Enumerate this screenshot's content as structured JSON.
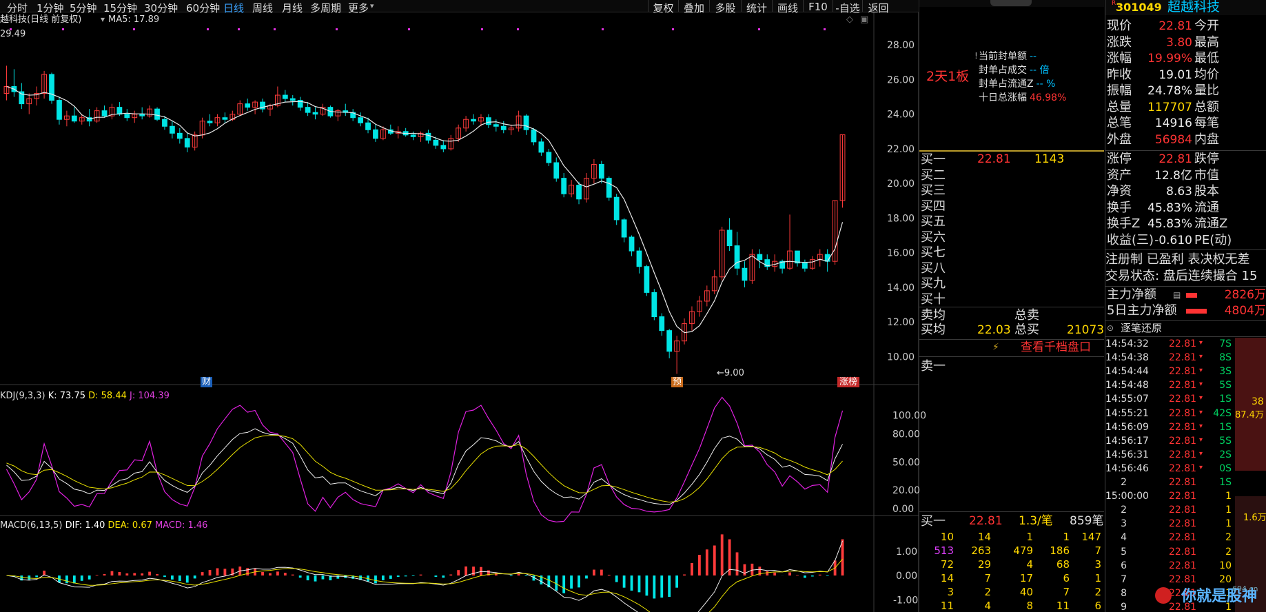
{
  "toolbar": {
    "tabs": [
      "分时",
      "1分钟",
      "5分钟",
      "15分钟",
      "30分钟",
      "60分钟",
      "日线",
      "周线",
      "月线",
      "多周期",
      "更多"
    ],
    "active": "日线",
    "right": [
      "复权",
      "叠加",
      "多股",
      "统计",
      "画线",
      "F10",
      "-自选",
      "返回"
    ]
  },
  "chart_header": {
    "title": "越科技(日线 前复权)",
    "ma5": "MA5: 17.89",
    "high_label": "29.49"
  },
  "markers": {
    "cai": "财",
    "yu": "预",
    "zhangbang": "涨榜",
    "low_label": "9.00"
  },
  "kdj_header": {
    "name": "KDJ(9,3,3)",
    "k": "K: 73.75",
    "d": "D: 58.44",
    "j": "J: 104.39"
  },
  "macd_header": {
    "name": "MACD(6,13,5)",
    "dif": "DIF: 1.40",
    "dea": "DEA: 0.67",
    "macd": "MACD: 1.46"
  },
  "price_axis": [
    "28.00",
    "26.00",
    "24.00",
    "22.00",
    "20.00",
    "18.00",
    "16.00",
    "14.00",
    "12.00",
    "10.00"
  ],
  "kdj_axis": [
    "100.00",
    "80.00",
    "50.00",
    "20.00",
    "0.00"
  ],
  "macd_axis": [
    "1.00",
    "0.00",
    "-1.00"
  ],
  "chart_data": {
    "type": "candlestick",
    "ohlc": [
      [
        25.2,
        26.8,
        24.8,
        25.6
      ],
      [
        25.6,
        26.6,
        25.0,
        25.3
      ],
      [
        25.3,
        25.8,
        24.3,
        24.6
      ],
      [
        24.6,
        25.2,
        24.0,
        24.9
      ],
      [
        24.9,
        25.6,
        24.5,
        25.2
      ],
      [
        25.2,
        26.5,
        24.9,
        26.3
      ],
      [
        26.3,
        26.4,
        24.6,
        24.8
      ],
      [
        24.8,
        25.0,
        23.4,
        23.7
      ],
      [
        23.7,
        24.2,
        23.3,
        23.9
      ],
      [
        23.9,
        24.4,
        23.5,
        23.6
      ],
      [
        23.6,
        24.0,
        23.4,
        23.8
      ],
      [
        23.8,
        24.3,
        23.3,
        23.6
      ],
      [
        23.6,
        24.4,
        23.5,
        24.2
      ],
      [
        24.2,
        24.5,
        23.8,
        23.9
      ],
      [
        23.9,
        24.6,
        23.7,
        24.4
      ],
      [
        24.4,
        24.7,
        23.9,
        24.0
      ],
      [
        24.0,
        24.3,
        23.6,
        23.8
      ],
      [
        23.8,
        24.2,
        23.5,
        24.0
      ],
      [
        24.0,
        24.4,
        23.7,
        23.9
      ],
      [
        23.9,
        24.5,
        23.8,
        24.3
      ],
      [
        24.3,
        24.4,
        23.6,
        23.7
      ],
      [
        23.7,
        23.9,
        23.1,
        23.3
      ],
      [
        23.3,
        23.6,
        22.6,
        22.9
      ],
      [
        22.9,
        23.2,
        22.3,
        22.6
      ],
      [
        22.6,
        22.9,
        21.8,
        22.1
      ],
      [
        22.1,
        23.0,
        21.9,
        22.8
      ],
      [
        22.8,
        23.8,
        22.6,
        23.6
      ],
      [
        23.6,
        24.0,
        23.3,
        23.5
      ],
      [
        23.5,
        24.0,
        23.3,
        23.8
      ],
      [
        23.8,
        24.1,
        23.5,
        23.7
      ],
      [
        23.7,
        24.2,
        23.6,
        24.0
      ],
      [
        24.0,
        24.8,
        23.9,
        24.6
      ],
      [
        24.6,
        24.9,
        24.2,
        24.4
      ],
      [
        24.4,
        24.8,
        24.0,
        24.7
      ],
      [
        24.7,
        24.9,
        24.1,
        24.3
      ],
      [
        24.3,
        24.6,
        23.9,
        24.5
      ],
      [
        24.5,
        25.6,
        24.4,
        25.1
      ],
      [
        25.1,
        25.4,
        24.7,
        24.9
      ],
      [
        24.9,
        25.1,
        24.5,
        24.8
      ],
      [
        24.8,
        25.0,
        24.2,
        24.4
      ],
      [
        24.4,
        24.7,
        23.9,
        24.1
      ],
      [
        24.1,
        24.4,
        23.7,
        24.0
      ],
      [
        24.0,
        24.6,
        23.9,
        24.4
      ],
      [
        24.4,
        24.5,
        23.8,
        23.9
      ],
      [
        23.9,
        24.3,
        23.6,
        24.2
      ],
      [
        24.2,
        24.6,
        23.9,
        24.1
      ],
      [
        24.1,
        24.3,
        23.6,
        23.8
      ],
      [
        23.8,
        24.1,
        23.3,
        23.5
      ],
      [
        23.5,
        23.8,
        22.9,
        23.1
      ],
      [
        23.1,
        23.4,
        22.4,
        22.6
      ],
      [
        22.6,
        23.3,
        22.5,
        23.1
      ],
      [
        23.1,
        23.4,
        22.8,
        22.9
      ],
      [
        22.9,
        23.3,
        22.6,
        23.0
      ],
      [
        23.0,
        23.2,
        22.7,
        22.8
      ],
      [
        22.8,
        23.0,
        22.5,
        22.7
      ],
      [
        22.7,
        23.0,
        22.4,
        22.9
      ],
      [
        22.9,
        23.1,
        22.3,
        22.5
      ],
      [
        22.5,
        22.7,
        22.0,
        22.2
      ],
      [
        22.2,
        22.5,
        21.8,
        22.0
      ],
      [
        22.0,
        22.8,
        21.9,
        22.6
      ],
      [
        22.6,
        23.4,
        22.4,
        23.2
      ],
      [
        23.2,
        23.9,
        23.0,
        23.7
      ],
      [
        23.7,
        24.0,
        23.4,
        23.6
      ],
      [
        23.6,
        24.0,
        23.3,
        23.8
      ],
      [
        23.8,
        24.0,
        23.2,
        23.4
      ],
      [
        23.4,
        23.7,
        23.0,
        23.3
      ],
      [
        23.3,
        23.6,
        22.9,
        23.1
      ],
      [
        23.1,
        23.4,
        22.8,
        23.2
      ],
      [
        23.2,
        24.2,
        23.0,
        23.9
      ],
      [
        23.9,
        24.0,
        22.8,
        23.1
      ],
      [
        23.1,
        23.2,
        22.2,
        22.4
      ],
      [
        22.4,
        22.6,
        21.6,
        21.8
      ],
      [
        21.8,
        22.0,
        21.0,
        21.2
      ],
      [
        21.2,
        21.5,
        20.1,
        20.3
      ],
      [
        20.3,
        20.6,
        19.2,
        19.4
      ],
      [
        19.4,
        20.2,
        19.2,
        19.9
      ],
      [
        19.9,
        20.1,
        18.8,
        19.1
      ],
      [
        19.1,
        20.6,
        18.9,
        20.3
      ],
      [
        20.3,
        21.4,
        20.0,
        21.1
      ],
      [
        21.1,
        21.3,
        20.0,
        20.3
      ],
      [
        20.3,
        20.4,
        19.0,
        19.2
      ],
      [
        19.2,
        19.4,
        17.6,
        17.9
      ],
      [
        17.9,
        18.0,
        16.6,
        16.9
      ],
      [
        16.9,
        17.0,
        15.8,
        16.1
      ],
      [
        16.1,
        16.3,
        14.8,
        15.2
      ],
      [
        15.2,
        15.3,
        13.5,
        13.7
      ],
      [
        13.7,
        13.9,
        12.1,
        12.3
      ],
      [
        12.3,
        12.5,
        11.2,
        11.5
      ],
      [
        11.5,
        11.6,
        9.9,
        10.3
      ],
      [
        10.3,
        11.2,
        9.0,
        10.9
      ],
      [
        10.9,
        12.2,
        10.7,
        11.9
      ],
      [
        11.9,
        12.9,
        11.5,
        12.6
      ],
      [
        12.6,
        13.5,
        12.3,
        13.2
      ],
      [
        13.2,
        14.1,
        12.9,
        13.8
      ],
      [
        13.8,
        15.0,
        13.6,
        14.6
      ],
      [
        14.6,
        17.5,
        14.4,
        17.3
      ],
      [
        17.3,
        18.0,
        16.1,
        16.4
      ],
      [
        16.4,
        17.2,
        14.7,
        15.1
      ],
      [
        15.1,
        15.5,
        14.0,
        14.4
      ],
      [
        14.4,
        16.2,
        14.2,
        15.9
      ],
      [
        15.9,
        16.2,
        15.1,
        15.6
      ],
      [
        15.6,
        15.9,
        15.0,
        15.2
      ],
      [
        15.2,
        15.9,
        14.9,
        15.5
      ],
      [
        15.5,
        15.6,
        14.8,
        15.1
      ],
      [
        15.1,
        18.2,
        15.0,
        16.1
      ],
      [
        16.1,
        16.1,
        15.2,
        15.4
      ],
      [
        15.4,
        15.6,
        14.9,
        15.1
      ],
      [
        15.1,
        15.8,
        15.0,
        15.6
      ],
      [
        15.6,
        16.2,
        15.2,
        15.9
      ],
      [
        15.9,
        16.2,
        14.9,
        15.5
      ],
      [
        15.5,
        19.0,
        15.3,
        19.01
      ],
      [
        19.01,
        22.81,
        18.6,
        22.81
      ]
    ],
    "price_range": [
      8.5,
      29.8
    ],
    "kdj_range": [
      -5,
      118
    ],
    "macd_range": [
      -1.5,
      1.9
    ]
  },
  "right_panel": {
    "board": "2天1板",
    "seal_lines": [
      {
        "label": "当前封单额",
        "value": "--"
      },
      {
        "label": "封单占成交",
        "value": "-- 倍"
      },
      {
        "label": "封单占流通Z",
        "value": "-- %"
      },
      {
        "label": "十日总涨幅",
        "value": "46.98%"
      }
    ],
    "buy_labels": [
      "买一",
      "买二",
      "买三",
      "买四",
      "买五",
      "买六",
      "买七",
      "买八",
      "买九",
      "买十"
    ],
    "buy1_price": "22.81",
    "buy1_vol": "1143",
    "sell_avg_label": "卖均",
    "sell_total_label": "总卖",
    "buy_avg_label": "买均",
    "buy_avg": "22.03",
    "buy_total_label": "总买",
    "buy_total": "21073",
    "qiandang": "查看千档盘口",
    "sell1": "卖一",
    "queue_header": {
      "label": "买一",
      "price": "22.81",
      "per": "1.3/笔",
      "count": "859笔"
    },
    "queue_rows": [
      [
        "10",
        "14",
        "1",
        "1",
        "147"
      ],
      [
        "513",
        "263",
        "479",
        "186",
        "7"
      ],
      [
        "72",
        "29",
        "4",
        "68",
        "3"
      ],
      [
        "14",
        "7",
        "17",
        "6",
        "1"
      ],
      [
        "3",
        "2",
        "40",
        "7",
        "2"
      ],
      [
        "11",
        "4",
        "8",
        "11",
        "6"
      ]
    ]
  },
  "quote": {
    "code": "301049",
    "name": "超越科技",
    "badge": "R",
    "rows": [
      {
        "l1": "现价",
        "v1": "22.81",
        "c1": "red",
        "l2": "今开"
      },
      {
        "l1": "涨跌",
        "v1": "3.80",
        "c1": "red",
        "l2": "最高"
      },
      {
        "l1": "涨幅",
        "v1": "19.99%",
        "c1": "red",
        "l2": "最低"
      },
      {
        "l1": "昨收",
        "v1": "19.01",
        "c1": "white",
        "l2": "均价"
      },
      {
        "l1": "振幅",
        "v1": "24.78%",
        "c1": "white",
        "l2": "量比"
      },
      {
        "l1": "总量",
        "v1": "117707",
        "c1": "yellow",
        "l2": "总额"
      },
      {
        "l1": "总笔",
        "v1": "14916",
        "c1": "white",
        "l2": "每笔"
      },
      {
        "l1": "外盘",
        "v1": "56984",
        "c1": "red",
        "l2": "内盘"
      }
    ],
    "rows2": [
      {
        "l1": "涨停",
        "v1": "22.81",
        "c1": "red",
        "l2": "跌停"
      },
      {
        "l1": "资产",
        "v1": "12.8亿",
        "c1": "white",
        "l2": "市值"
      },
      {
        "l1": "净资",
        "v1": "8.63",
        "c1": "white",
        "l2": "股本"
      },
      {
        "l1": "换手",
        "v1": "45.83%",
        "c1": "white",
        "l2": "流通"
      },
      {
        "l1": "换手Z",
        "v1": "45.83%",
        "c1": "white",
        "l2": "流通Z"
      },
      {
        "l1": "收益(三)",
        "v1": "-0.610",
        "c1": "white",
        "l2": "PE(动)"
      }
    ],
    "reg": "注册制 已盈利 表决权无差",
    "trade_status": "交易状态: 盘后连续撮合 15",
    "main_net": {
      "label": "主力净额",
      "value": "2826万"
    },
    "main_net5": {
      "label": "5日主力净额",
      "value": "4804万"
    },
    "ticks_title": "逐笔还原",
    "ticks": [
      {
        "t": "14:54:32",
        "p": "22.81",
        "v": "7S"
      },
      {
        "t": "14:54:38",
        "p": "22.81",
        "v": "8S"
      },
      {
        "t": "14:54:44",
        "p": "22.81",
        "v": "3S"
      },
      {
        "t": "14:54:48",
        "p": "22.81",
        "v": "5S"
      },
      {
        "t": "14:55:07",
        "p": "22.81",
        "v": "1S"
      },
      {
        "t": "14:55:21",
        "p": "22.81",
        "v": "42S"
      },
      {
        "t": "14:56:09",
        "p": "22.81",
        "v": "1S"
      },
      {
        "t": "14:56:17",
        "p": "22.81",
        "v": "5S"
      },
      {
        "t": "14:56:31",
        "p": "22.81",
        "v": "2S"
      },
      {
        "t": "14:56:46",
        "p": "22.81",
        "v": "0S"
      },
      {
        "t": "2",
        "p": "22.81",
        "v": "1S"
      },
      {
        "t": "15:00:00",
        "p": "22.81",
        "v": "1"
      },
      {
        "t": "2",
        "p": "22.81",
        "v": "1"
      },
      {
        "t": "3",
        "p": "22.81",
        "v": "1"
      },
      {
        "t": "4",
        "p": "22.81",
        "v": "2"
      },
      {
        "t": "5",
        "p": "22.81",
        "v": "2"
      },
      {
        "t": "6",
        "p": "22.81",
        "v": "10"
      },
      {
        "t": "7",
        "p": "22.81",
        "v": "20"
      },
      {
        "t": "8",
        "p": "22.81",
        "v": "1"
      },
      {
        "t": "9",
        "p": "22.81",
        "v": "1"
      }
    ],
    "side_vals": [
      "38",
      "87.4万",
      "1.6万"
    ],
    "watermark": "你就是股神",
    "watermark_site": "694.cn"
  }
}
